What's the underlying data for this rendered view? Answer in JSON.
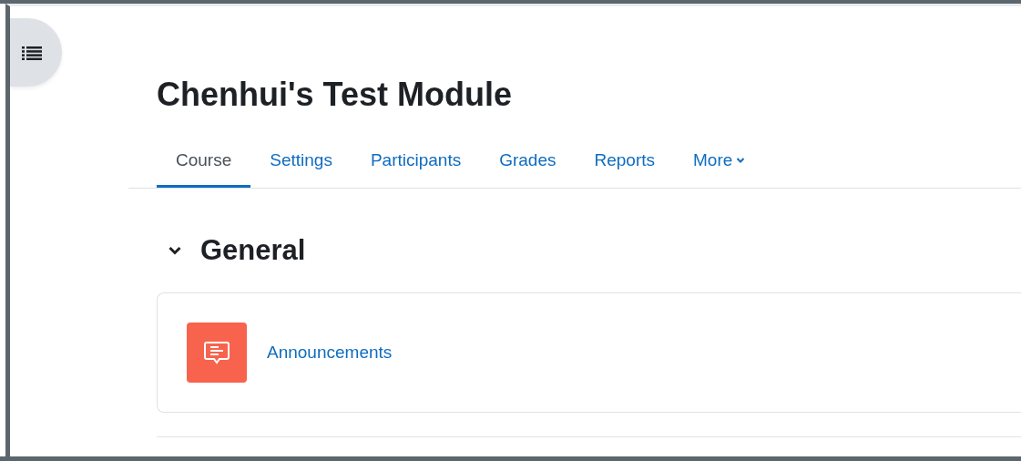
{
  "course": {
    "title": "Chenhui's Test Module"
  },
  "tabs": [
    {
      "label": "Course",
      "selected": true,
      "kind": "link"
    },
    {
      "label": "Settings",
      "selected": false,
      "kind": "link"
    },
    {
      "label": "Participants",
      "selected": false,
      "kind": "link"
    },
    {
      "label": "Grades",
      "selected": false,
      "kind": "link"
    },
    {
      "label": "Reports",
      "selected": false,
      "kind": "link"
    },
    {
      "label": "More",
      "selected": false,
      "kind": "menu"
    }
  ],
  "sections": [
    {
      "title": "General",
      "expanded": true,
      "activities": [
        {
          "name": "Announcements",
          "kind": "forum"
        }
      ]
    }
  ]
}
